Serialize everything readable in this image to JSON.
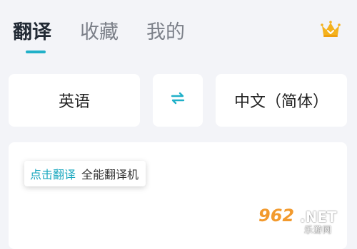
{
  "header": {
    "tabs": [
      {
        "label": "翻译",
        "active": true
      },
      {
        "label": "收藏",
        "active": false
      },
      {
        "label": "我的",
        "active": false
      }
    ],
    "vip_icon": "crown-icon"
  },
  "language_bar": {
    "source": "英语",
    "target": "中文（简体）",
    "swap_icon": "swap-arrows-icon"
  },
  "input_area": {
    "tooltip_link": "点击翻译",
    "tooltip_text": "全能翻译机"
  },
  "watermark": {
    "number": "962",
    "domain": ".NET",
    "sub": "乐游网"
  },
  "colors": {
    "accent": "#20b0c8",
    "crown": "#f4b21e",
    "background": "#f3f4f8"
  }
}
